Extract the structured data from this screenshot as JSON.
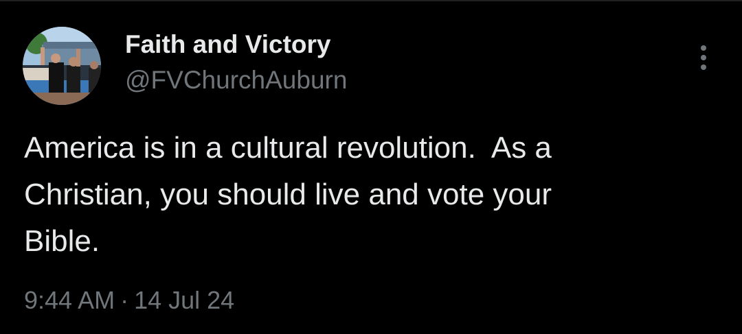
{
  "tweet": {
    "author": {
      "display_name": "Faith and Victory",
      "handle": "@FVChurchAuburn",
      "avatar": "profile-photo"
    },
    "text": "America is in a cultural revolution.  As a\nChristian, you should live and vote your\nBible.",
    "time": "9:44 AM",
    "separator": "·",
    "date": "14 Jul 24",
    "more_icon": "more-vertical-icon"
  },
  "colors": {
    "background": "#000000",
    "text_primary": "#e7e9ea",
    "text_secondary": "#71767b"
  }
}
